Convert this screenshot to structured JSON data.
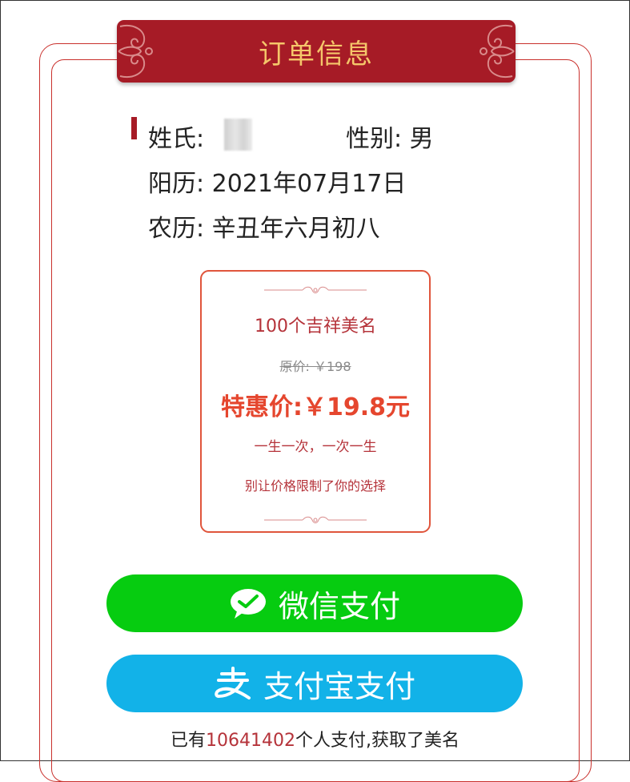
{
  "header": {
    "title": "订单信息"
  },
  "info": {
    "surname_label": "姓氏:",
    "gender_label": "性别:",
    "gender_value": "男",
    "solar_label": "阳历:",
    "solar_value": "2021年07月17日",
    "lunar_label": "农历:",
    "lunar_value": "辛丑年六月初八"
  },
  "package": {
    "title": "100个吉祥美名",
    "original_price": "原价: ￥198",
    "sale_price": "特惠价:￥19.8元",
    "slogan1": "一生一次，一次一生",
    "slogan2": "别让价格限制了你的选择"
  },
  "buttons": {
    "wechat_label": "微信支付",
    "alipay_label": "支付宝支付"
  },
  "footer": {
    "prefix": "已有",
    "count": "10641402",
    "suffix": "个人支付,获取了美名"
  },
  "colors": {
    "brand_red": "#a61b26",
    "gold": "#f5c66a",
    "price_red": "#e5462e",
    "wechat_green": "#06cc10",
    "alipay_blue": "#12b2e8"
  },
  "icons": {
    "wechat": "wechat-icon",
    "alipay": "alipay-icon",
    "ornament": "cloud-ornament-icon"
  }
}
